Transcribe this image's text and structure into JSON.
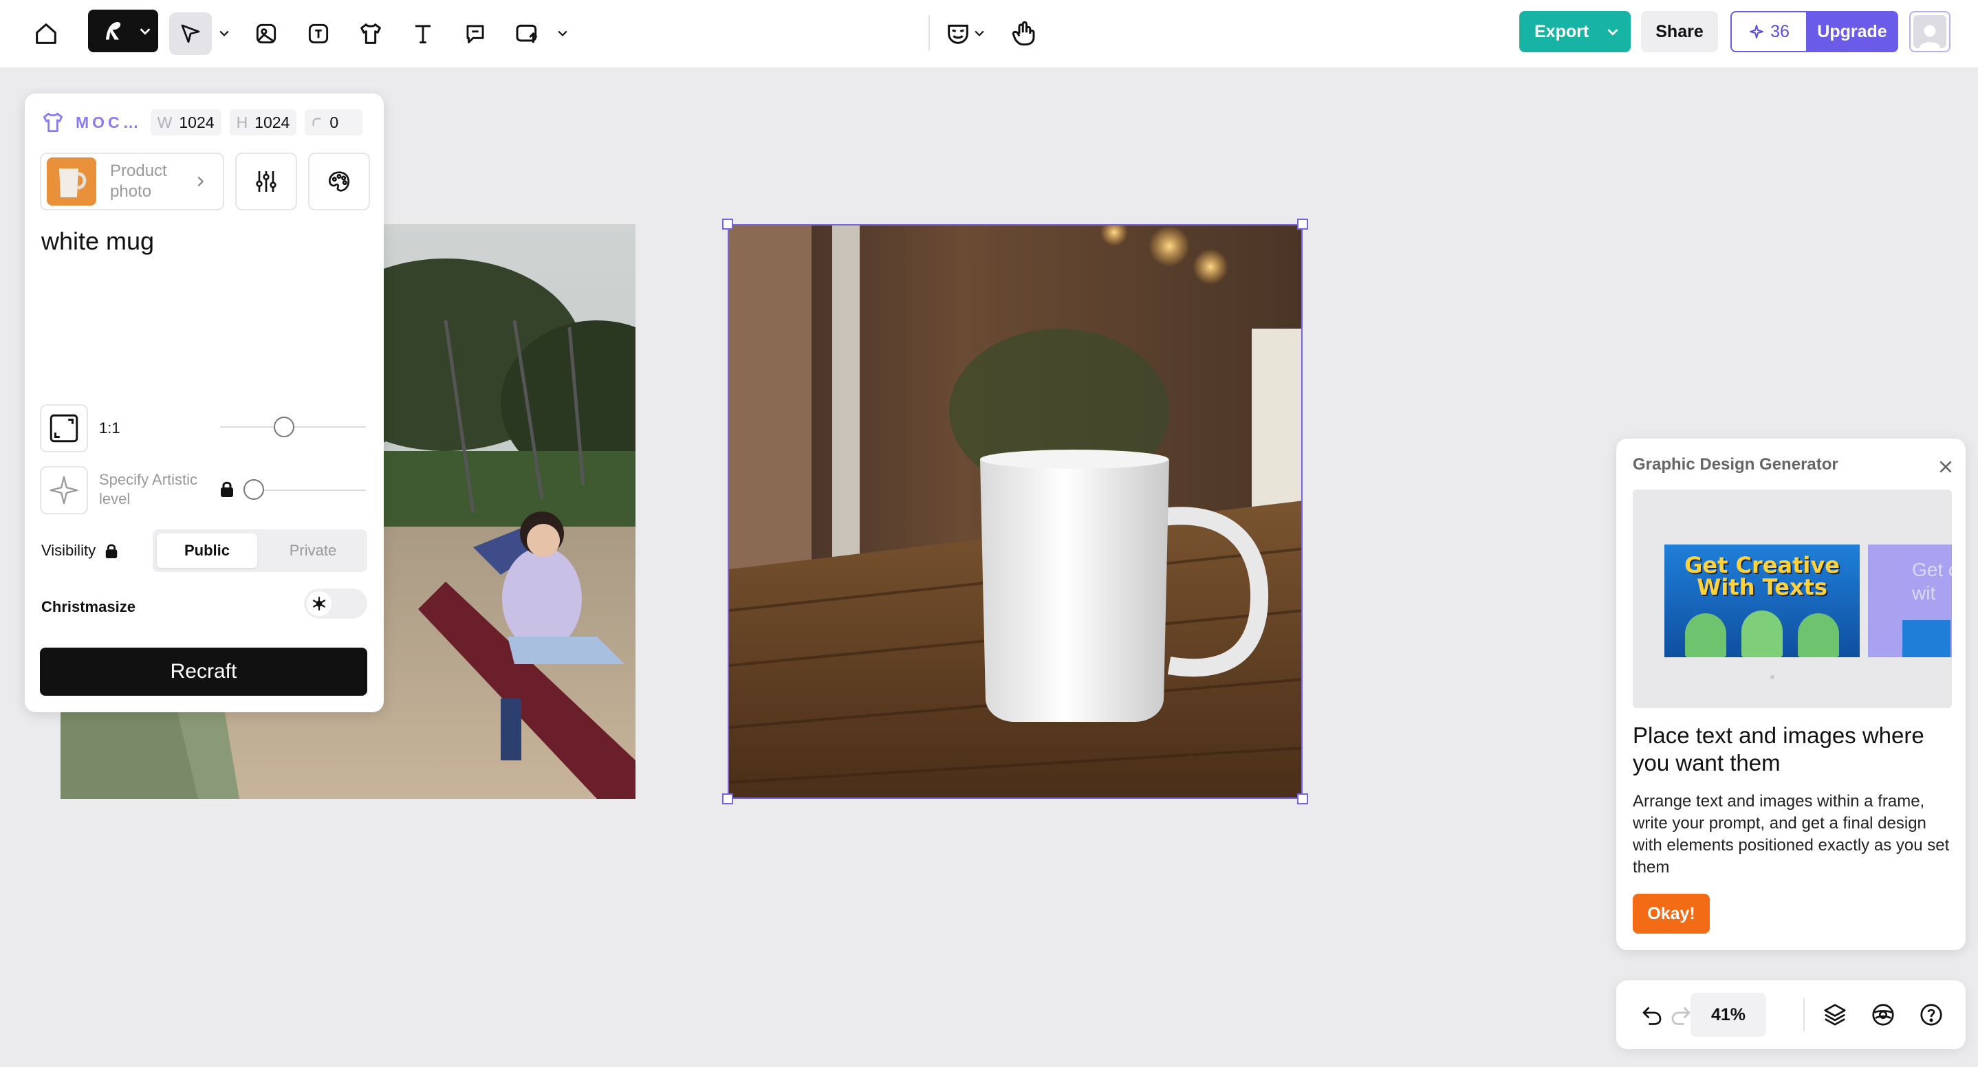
{
  "topbar": {
    "export_label": "Export",
    "share_label": "Share",
    "credits": "36",
    "upgrade_label": "Upgrade",
    "icons": [
      "home-icon",
      "recraft-logo",
      "pointer-icon",
      "image-icon",
      "text-to-image-icon",
      "mockup-icon",
      "text-icon",
      "comment-icon",
      "upload-icon",
      "face-icon",
      "hand-icon"
    ]
  },
  "panel": {
    "mode_label": "MOC…",
    "width_key": "W",
    "width": "1024",
    "height_key": "H",
    "height": "1024",
    "radius": "0",
    "style_label": "Product photo",
    "prompt": "white mug",
    "aspect_ratio": "1:1",
    "artistic_label": "Specify Artistic level",
    "visibility_label": "Visibility",
    "public_label": "Public",
    "private_label": "Private",
    "christmasize_label": "Christmasize",
    "recraft_label": "Recraft"
  },
  "tip": {
    "title": "Graphic Design Generator",
    "preview_text": "Get Creative With Texts",
    "preview_text_2": "Get c wit",
    "heading": "Place text and images where you want them",
    "body": "Arrange text and images within a frame, write your prompt, and get a final design with elements positioned exactly as you set them",
    "ok_label": "Okay!"
  },
  "bottom": {
    "zoom": "41%"
  },
  "colors": {
    "accent": "#6a5be8",
    "export": "#17b3a4",
    "ok": "#f46b16",
    "canvas": "#ebebee"
  }
}
